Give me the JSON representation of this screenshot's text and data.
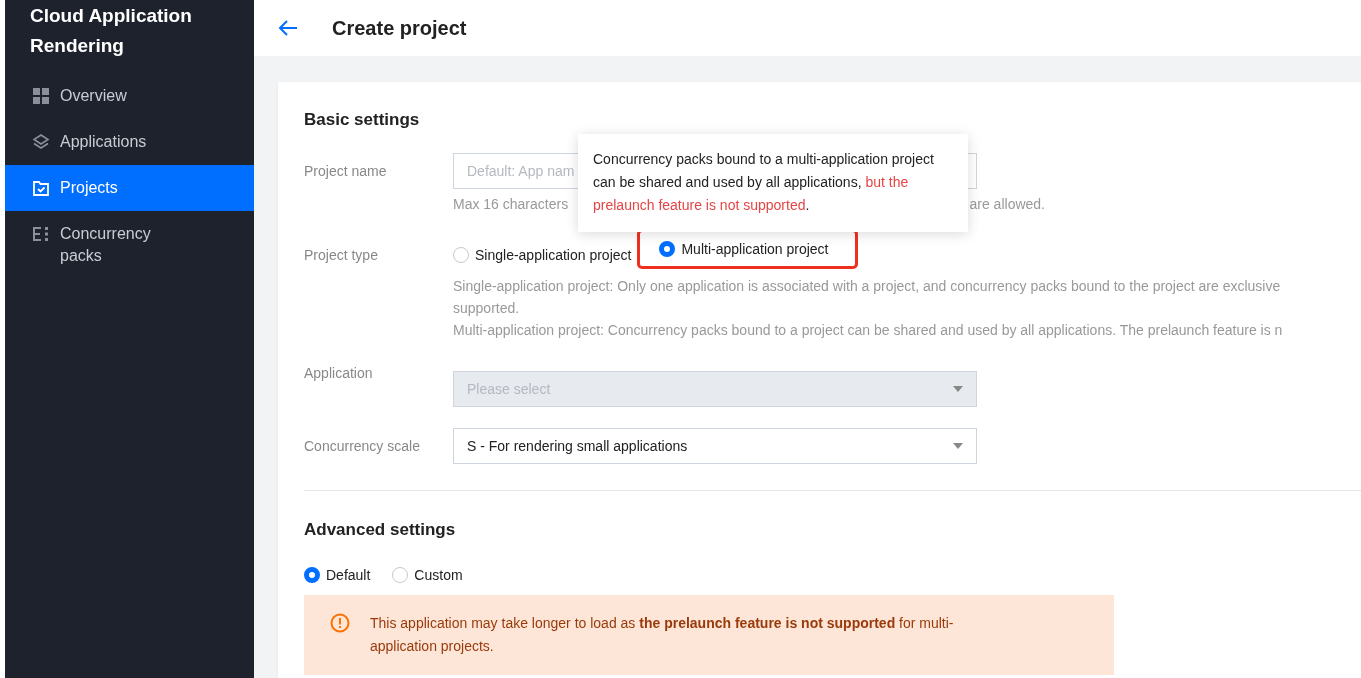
{
  "sidebar": {
    "title": "Cloud Application Rendering",
    "items": [
      {
        "label": "Overview",
        "selected": false
      },
      {
        "label": "Applications",
        "selected": false
      },
      {
        "label": "Projects",
        "selected": true
      },
      {
        "label": "Concurrency packs",
        "selected": false
      }
    ]
  },
  "header": {
    "title": "Create project"
  },
  "basic_settings": {
    "heading": "Basic settings",
    "project_name": {
      "label": "Project name",
      "placeholder": "Default: App nam",
      "hint_start": "Max 16 characters",
      "hint_end": "are allowed."
    },
    "project_type": {
      "label": "Project type",
      "options": [
        {
          "label": "Single-application project",
          "selected": false,
          "highlighted": false
        },
        {
          "label": "Multi-application project",
          "selected": true,
          "highlighted": true
        }
      ],
      "descriptions": [
        "Single-application project: Only one application is associated with a project, and concurrency packs bound to the project are exclusive",
        "supported.",
        "Multi-application project: Concurrency packs bound to a project can be shared and used by all applications. The prelaunch feature is n"
      ]
    },
    "application": {
      "label": "Application",
      "placeholder": "Please select",
      "disabled": true
    },
    "concurrency_scale": {
      "label": "Concurrency scale",
      "value": "S - For rendering small applications"
    }
  },
  "tooltip": {
    "text": "Concurrency packs bound to a multi-application project can be shared and used by all applications, ",
    "warning": "but the prelaunch feature is not supported",
    "end": "."
  },
  "advanced_settings": {
    "heading": "Advanced settings",
    "options": [
      {
        "label": "Default",
        "selected": true
      },
      {
        "label": "Custom",
        "selected": false
      }
    ],
    "alert": {
      "text": "This application may take longer to load as **the prelaunch feature is not supported** for multi-application projects."
    }
  }
}
